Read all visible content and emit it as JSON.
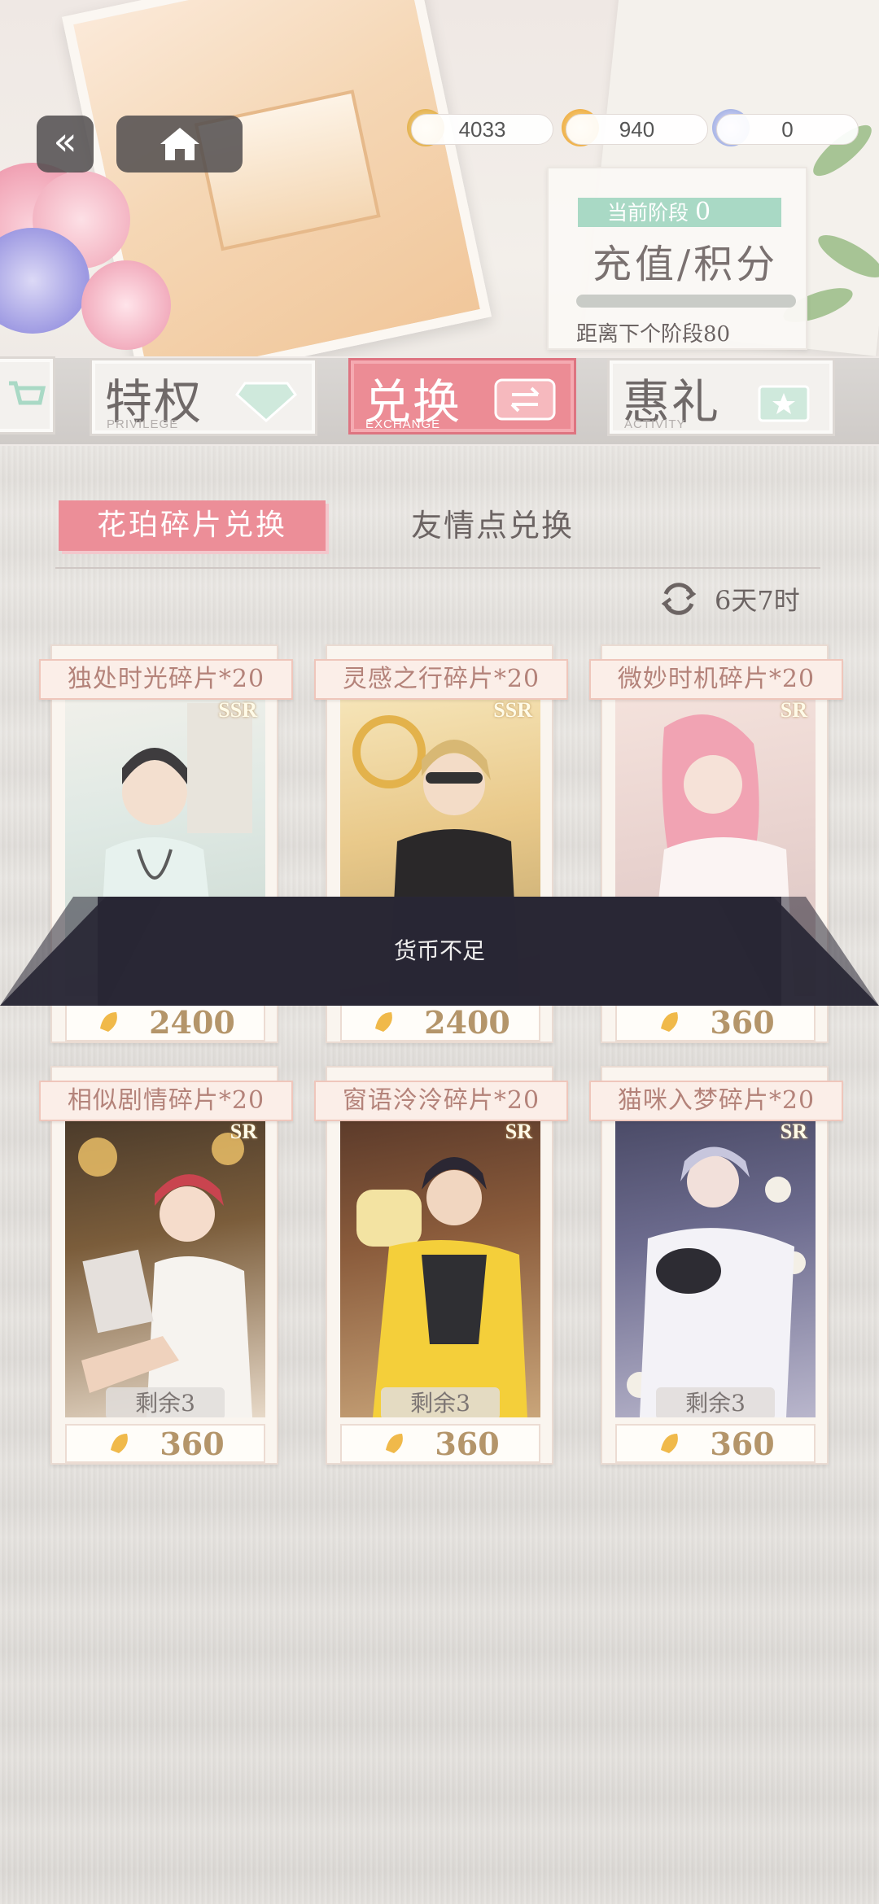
{
  "top": {
    "currencies": [
      {
        "icon": "gold-coin-icon",
        "value": "4033"
      },
      {
        "icon": "stamina-icon",
        "value": "940"
      },
      {
        "icon": "diamond-icon",
        "value": "0"
      }
    ]
  },
  "stage": {
    "label": "当前阶段",
    "stage_number": "0",
    "title": "充值/积分",
    "next_text": "距离下个阶段",
    "next_value": "80"
  },
  "tabs": [
    {
      "title": "特权",
      "sub": "PRIVILEGE",
      "active": false
    },
    {
      "title": "兑换",
      "sub": "EXCHANGE",
      "active": true
    },
    {
      "title": "惠礼",
      "sub": "ACTIVITY",
      "active": false
    }
  ],
  "subtabs": {
    "active": "花珀碎片兑换",
    "inactive": "友情点兑换"
  },
  "refresh": {
    "time": "6天7时"
  },
  "cards": [
    {
      "name": "独处时光碎片*20",
      "rarity": "SSR",
      "price": "2400",
      "remain": ""
    },
    {
      "name": "灵感之行碎片*20",
      "rarity": "SSR",
      "price": "2400",
      "remain": ""
    },
    {
      "name": "微妙时机碎片*20",
      "rarity": "SR",
      "price": "360",
      "remain": ""
    },
    {
      "name": "相似剧情碎片*20",
      "rarity": "SR",
      "price": "360",
      "remain": "剩余3"
    },
    {
      "name": "窗语泠泠碎片*20",
      "rarity": "SR",
      "price": "360",
      "remain": "剩余3"
    },
    {
      "name": "猫咪入梦碎片*20",
      "rarity": "SR",
      "price": "360",
      "remain": "剩余3"
    }
  ],
  "toast": {
    "message": "货币不足"
  },
  "colors": {
    "accent_pink": "#ec8c95",
    "mint": "#a9d9c5",
    "text_brown": "#6c6463",
    "price_gold": "#b4956a"
  }
}
